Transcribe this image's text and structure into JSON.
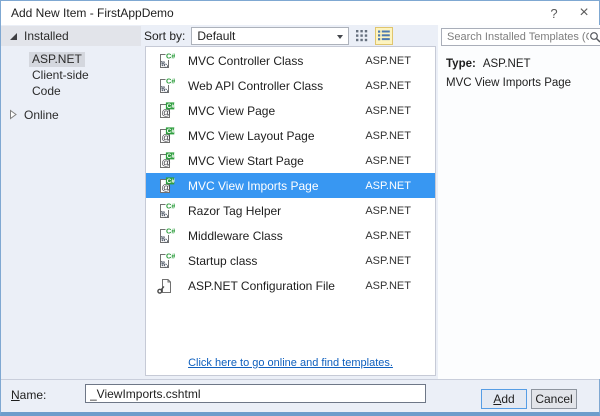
{
  "window": {
    "title": "Add New Item - FirstAppDemo",
    "help_glyph": "?",
    "close_glyph": "×"
  },
  "sidebar": {
    "installed_label": "Installed",
    "items": [
      {
        "label": "ASP.NET",
        "selected": true
      },
      {
        "label": "Client-side",
        "selected": false
      },
      {
        "label": "Code",
        "selected": false
      }
    ],
    "online_label": "Online"
  },
  "toolbar": {
    "sort_by_label": "Sort by:",
    "sort_value": "Default",
    "view_modes": [
      "small-icons-view",
      "list-view"
    ],
    "active_view": "list-view"
  },
  "search": {
    "placeholder": "Search Installed Templates (Ctrl+E)"
  },
  "templates": {
    "items": [
      {
        "name": "MVC Controller Class",
        "category": "ASP.NET",
        "icon": "csharp-class",
        "selected": false
      },
      {
        "name": "Web API Controller Class",
        "category": "ASP.NET",
        "icon": "csharp-class",
        "selected": false
      },
      {
        "name": "MVC View Page",
        "category": "ASP.NET",
        "icon": "csharp-view-page",
        "selected": false
      },
      {
        "name": "MVC View Layout Page",
        "category": "ASP.NET",
        "icon": "csharp-view-page",
        "selected": false
      },
      {
        "name": "MVC View Start Page",
        "category": "ASP.NET",
        "icon": "csharp-view-page",
        "selected": false
      },
      {
        "name": "MVC View Imports Page",
        "category": "ASP.NET",
        "icon": "csharp-view-page",
        "selected": true
      },
      {
        "name": "Razor Tag Helper",
        "category": "ASP.NET",
        "icon": "csharp-class",
        "selected": false
      },
      {
        "name": "Middleware Class",
        "category": "ASP.NET",
        "icon": "csharp-class",
        "selected": false
      },
      {
        "name": "Startup class",
        "category": "ASP.NET",
        "icon": "csharp-class",
        "selected": false
      },
      {
        "name": "ASP.NET Configuration File",
        "category": "ASP.NET",
        "icon": "config-file",
        "selected": false
      }
    ],
    "online_link": "Click here to go online and find templates."
  },
  "details": {
    "type_label": "Type:",
    "type_value": "ASP.NET",
    "description": "MVC View Imports Page"
  },
  "footer": {
    "name_label": "Name:",
    "name_value": "_ViewImports.cshtml",
    "add_label": "Add",
    "cancel_label": "Cancel"
  },
  "colors": {
    "selection": "#3897F2",
    "window_border": "#7FA8D2",
    "window_border_bottom": "#6E9DCB",
    "link": "#0E5FBE",
    "csharp_green": "#2E9E3E",
    "active_view_button_bg": "#FDF4BF",
    "active_view_button_border": "#E0C56E"
  }
}
